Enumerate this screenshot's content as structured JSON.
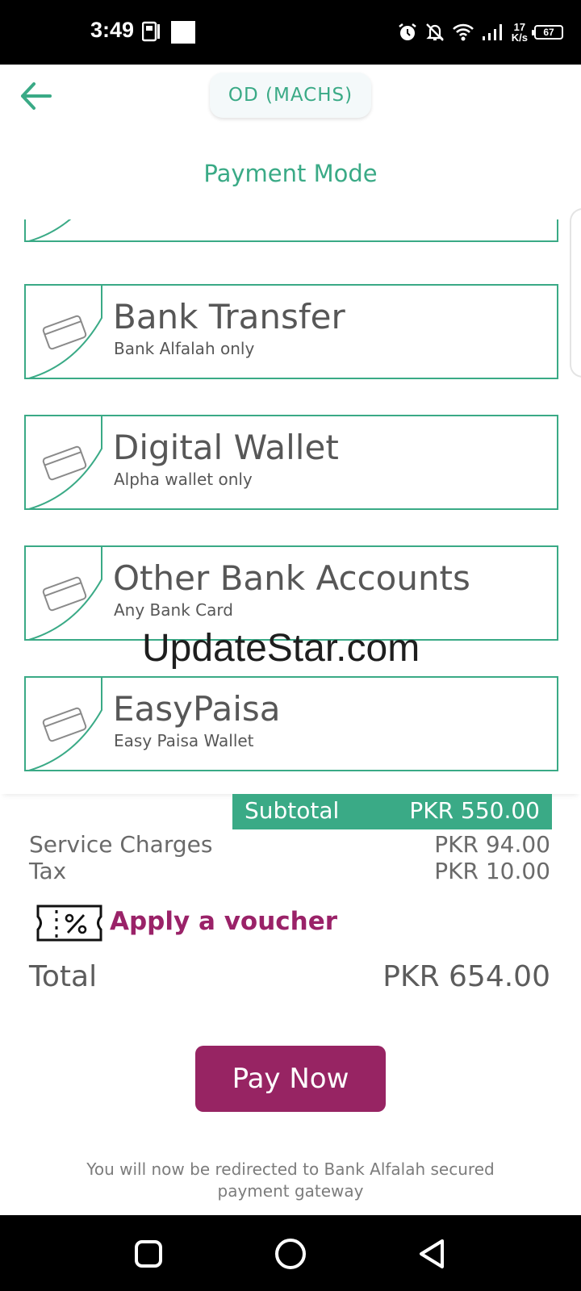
{
  "status_bar": {
    "time": "3:49",
    "net_speed_value": "17",
    "net_speed_unit": "K/s",
    "battery": "67",
    "icons": [
      "alarm-icon",
      "notifications-off-icon",
      "wifi-icon",
      "signal-icon"
    ]
  },
  "header": {
    "back_icon": "arrow-left-icon",
    "merchant": "OD (MACHS)",
    "title": "Payment Mode"
  },
  "methods": [
    {
      "title": "Bank Transfer",
      "subtitle": "Bank Alfalah only",
      "icon": "credit-card-icon"
    },
    {
      "title": "Digital Wallet",
      "subtitle": "Alpha wallet only",
      "icon": "credit-card-icon"
    },
    {
      "title": "Other Bank Accounts",
      "subtitle": "Any Bank Card",
      "icon": "credit-card-icon"
    },
    {
      "title": "EasyPaisa",
      "subtitle": "Easy Paisa Wallet",
      "icon": "credit-card-icon"
    }
  ],
  "summary": {
    "subtotal_label": "Subtotal",
    "subtotal_value": "PKR 550.00",
    "service_label": "Service Charges",
    "service_value": "PKR 94.00",
    "tax_label": "Tax",
    "tax_value": "PKR 10.00",
    "voucher_label": "Apply a voucher",
    "total_label": "Total",
    "total_value": "PKR 654.00"
  },
  "pay_button": "Pay Now",
  "redirect_note": "You will now be redirected to Bank Alfalah secured payment gateway",
  "watermark": "UpdateStar.com",
  "colors": {
    "accent_green": "#3aaa86",
    "brand_maroon": "#972463",
    "text_gray": "#5a5a5a"
  }
}
